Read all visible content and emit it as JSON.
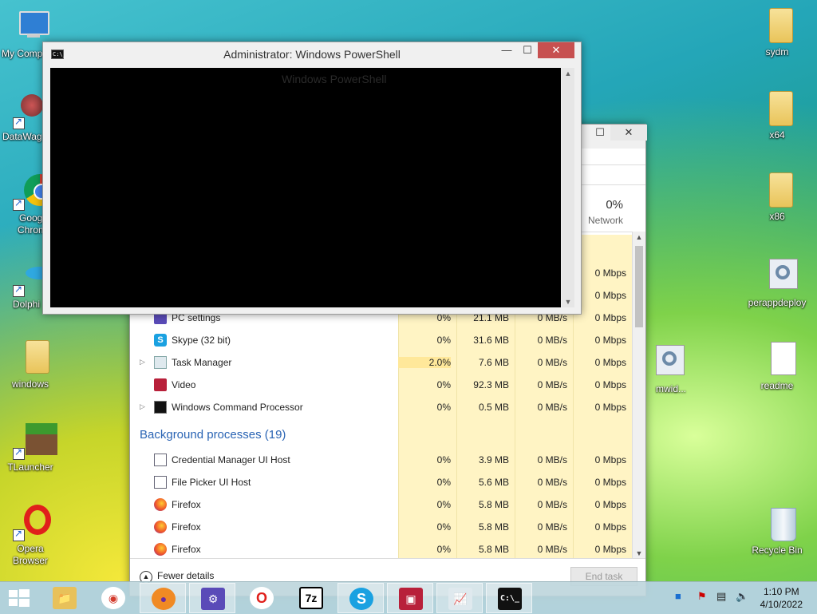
{
  "desktop_icons_left": [
    {
      "name": "my-computer",
      "label": "My Comp"
    },
    {
      "name": "datawag",
      "label": "DataWag"
    },
    {
      "name": "google-chrome",
      "label": "Googl Chrom"
    },
    {
      "name": "dolphin",
      "label": "Dolphi"
    },
    {
      "name": "windows-folder",
      "label": "windows"
    },
    {
      "name": "tlauncher",
      "label": "TLauncher"
    },
    {
      "name": "opera-browser",
      "label": "Opera Browser"
    }
  ],
  "desktop_icons_right": [
    {
      "name": "sydm-folder",
      "label": "sydm"
    },
    {
      "name": "x64-folder",
      "label": "x64"
    },
    {
      "name": "x86-folder",
      "label": "x86"
    },
    {
      "name": "perappdeploy",
      "label": "perappdeploy"
    },
    {
      "name": "readme",
      "label": "readme"
    },
    {
      "name": "recycle-bin",
      "label": "Recycle Bin"
    }
  ],
  "hidden_icon_label": "mwid...",
  "powershell": {
    "title": "Administrator: Windows PowerShell",
    "ghost_title": "Windows PowerShell",
    "icon_text": "C:\\_",
    "min": "—",
    "max": "☐",
    "close": "✕"
  },
  "task_manager": {
    "min": "—",
    "max": "☐",
    "close": "✕",
    "network_pct": "0%",
    "network_label": "Network",
    "apps": [
      {
        "name": "PC settings",
        "cpu": "0%",
        "mem": "21.1 MB",
        "disk": "0 MB/s",
        "net": "0 Mbps"
      },
      {
        "name": "Skype (32 bit)",
        "cpu": "0%",
        "mem": "31.6 MB",
        "disk": "0 MB/s",
        "net": "0 Mbps"
      },
      {
        "name": "Task Manager",
        "cpu": "2.0%",
        "mem": "7.6 MB",
        "disk": "0 MB/s",
        "net": "0 Mbps"
      },
      {
        "name": "Video",
        "cpu": "0%",
        "mem": "92.3 MB",
        "disk": "0 MB/s",
        "net": "0 Mbps"
      },
      {
        "name": "Windows Command Processor",
        "cpu": "0%",
        "mem": "0.5 MB",
        "disk": "0 MB/s",
        "net": "0 Mbps"
      }
    ],
    "upper_net_values": [
      "0 Mbps",
      "0 Mbps"
    ],
    "background_header": "Background processes (19)",
    "background": [
      {
        "name": "Credential Manager UI Host",
        "cpu": "0%",
        "mem": "3.9 MB",
        "disk": "0 MB/s",
        "net": "0 Mbps"
      },
      {
        "name": "File Picker UI Host",
        "cpu": "0%",
        "mem": "5.6 MB",
        "disk": "0 MB/s",
        "net": "0 Mbps"
      },
      {
        "name": "Firefox",
        "cpu": "0%",
        "mem": "5.8 MB",
        "disk": "0 MB/s",
        "net": "0 Mbps"
      },
      {
        "name": "Firefox",
        "cpu": "0%",
        "mem": "5.8 MB",
        "disk": "0 MB/s",
        "net": "0 Mbps"
      },
      {
        "name": "Firefox",
        "cpu": "0%",
        "mem": "5.8 MB",
        "disk": "0 MB/s",
        "net": "0 Mbps"
      }
    ],
    "fewer_details": "Fewer details",
    "end_task": "End task"
  },
  "taskbar": {
    "apps": [
      {
        "name": "file-explorer",
        "glyph": "📁",
        "color": "#e8c15a",
        "text": "#7a5a10"
      },
      {
        "name": "chrome",
        "glyph": "◉",
        "color": "#ffffff",
        "text": "#d33a2c"
      },
      {
        "name": "firefox",
        "glyph": "●",
        "color": "#f08a24",
        "text": "#6a2ca0"
      },
      {
        "name": "settings",
        "glyph": "⚙",
        "color": "#5a4bb8",
        "text": "#ffffff"
      },
      {
        "name": "opera",
        "glyph": "O",
        "color": "#ffffff",
        "text": "#e0201b"
      },
      {
        "name": "7zip",
        "glyph": "7z",
        "color": "#ffffff",
        "text": "#000000"
      },
      {
        "name": "skype",
        "glyph": "S",
        "color": "#1aa1e1",
        "text": "#ffffff"
      },
      {
        "name": "video",
        "glyph": "▣",
        "color": "#b8203a",
        "text": "#ffffff"
      },
      {
        "name": "task-manager",
        "glyph": "📈",
        "color": "#dfe9ee",
        "text": "#2a6a9a"
      },
      {
        "name": "powershell",
        "glyph": "C:\\_",
        "color": "#111111",
        "text": "#ffffff"
      }
    ],
    "time": "1:10 PM",
    "date": "4/10/2022"
  }
}
